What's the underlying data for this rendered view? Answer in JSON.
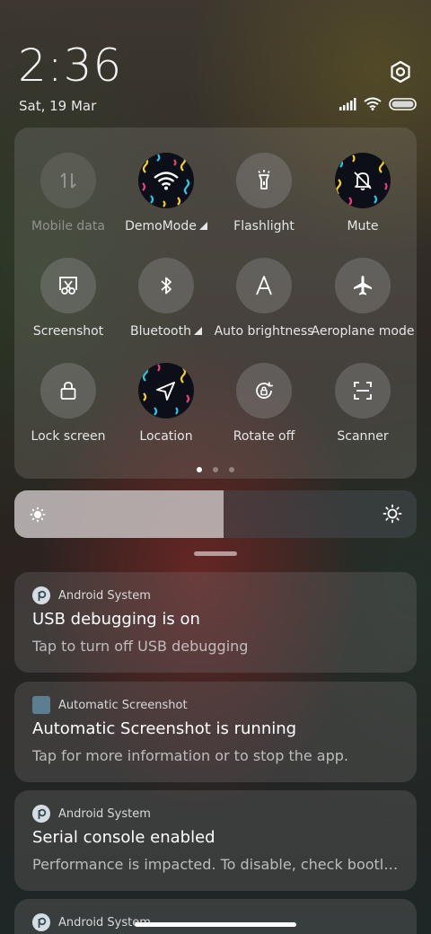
{
  "status": {
    "time": "2:36",
    "date": "Sat, 19 Mar",
    "icons": [
      "signal-icon",
      "wifi-icon",
      "battery-icon"
    ]
  },
  "quick_settings": {
    "tiles": [
      {
        "label": "Mobile data",
        "icon": "mobile-data-icon",
        "state": "disabled"
      },
      {
        "label": "DemoMode",
        "icon": "wifi-icon",
        "state": "active",
        "expandable": true
      },
      {
        "label": "Flashlight",
        "icon": "flashlight-icon",
        "state": "off"
      },
      {
        "label": "Mute",
        "icon": "bell-off-icon",
        "state": "active"
      },
      {
        "label": "Screenshot",
        "icon": "screenshot-icon",
        "state": "off"
      },
      {
        "label": "Bluetooth",
        "icon": "bluetooth-icon",
        "state": "off",
        "expandable": true
      },
      {
        "label": "Auto brightness",
        "icon": "auto-brightness-icon",
        "state": "off"
      },
      {
        "label": "Aeroplane mode",
        "icon": "airplane-icon",
        "state": "off"
      },
      {
        "label": "Lock screen",
        "icon": "lock-icon",
        "state": "off"
      },
      {
        "label": "Location",
        "icon": "location-icon",
        "state": "active"
      },
      {
        "label": "Rotate off",
        "icon": "rotate-lock-icon",
        "state": "off"
      },
      {
        "label": "Scanner",
        "icon": "scanner-icon",
        "state": "off"
      }
    ],
    "pages": 3,
    "current_page": 1
  },
  "brightness": {
    "level": 0.52
  },
  "notifications": [
    {
      "app": "Android System",
      "icon": "android-system-icon",
      "title": "USB debugging is on",
      "text": "Tap to turn off USB debugging"
    },
    {
      "app": "Automatic Screenshot",
      "icon": "automatic-screenshot-icon",
      "title": "Automatic Screenshot is running",
      "text": "Tap for more information or to stop the app."
    },
    {
      "app": "Android System",
      "icon": "android-system-icon",
      "title": "Serial console enabled",
      "text": "Performance is impacted. To disable, check bootl…"
    },
    {
      "app": "Android System",
      "icon": "android-system-icon",
      "title": "",
      "text": ""
    }
  ],
  "colors": {
    "active_tile": "#0d0f18",
    "inactive_tile": "#8a8580"
  }
}
